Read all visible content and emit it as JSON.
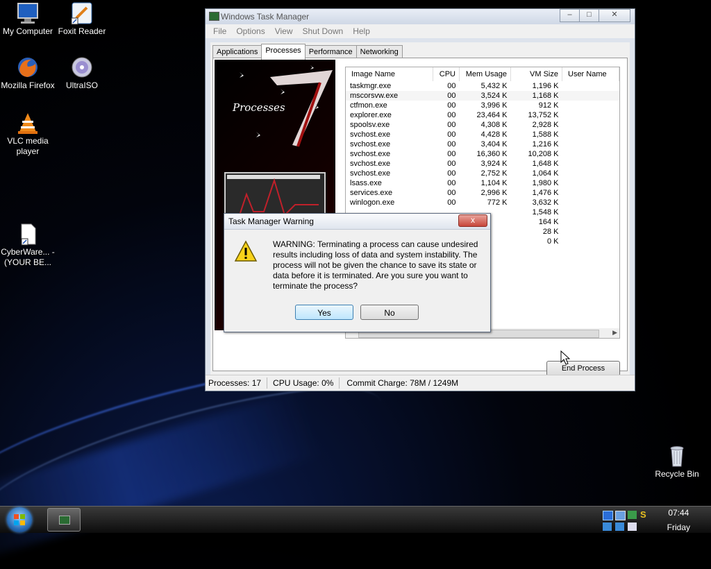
{
  "desktop": {
    "icons": [
      {
        "label": "My Computer",
        "icon": "computer-icon"
      },
      {
        "label": "Foxit Reader",
        "icon": "pdf-reader-icon"
      },
      {
        "label": "Mozilla Firefox",
        "icon": "firefox-icon"
      },
      {
        "label": "UltraISO",
        "icon": "disc-icon"
      },
      {
        "label": "VLC media player",
        "icon": "vlc-icon"
      },
      {
        "label": "CyberWare... - (YOUR BE...",
        "icon": "file-shortcut-icon"
      },
      {
        "label": "Recycle Bin",
        "icon": "recycle-bin-icon"
      }
    ]
  },
  "task_manager": {
    "title": "Windows Task Manager",
    "menu": [
      "File",
      "Options",
      "View",
      "Shut Down",
      "Help"
    ],
    "tabs": [
      "Applications",
      "Processes",
      "Performance",
      "Networking"
    ],
    "active_tab": "Processes",
    "art_label": "Processes",
    "columns": [
      "Image Name",
      "CPU",
      "Mem Usage",
      "VM Size",
      "User Name"
    ],
    "rows": [
      [
        "taskmgr.exe",
        "00",
        "5,432 K",
        "1,196 K",
        ""
      ],
      [
        "mscorsvw.exe",
        "00",
        "3,524 K",
        "1,168 K",
        ""
      ],
      [
        "ctfmon.exe",
        "00",
        "3,996 K",
        "912 K",
        ""
      ],
      [
        "explorer.exe",
        "00",
        "23,464 K",
        "13,752 K",
        ""
      ],
      [
        "spoolsv.exe",
        "00",
        "4,308 K",
        "2,928 K",
        ""
      ],
      [
        "svchost.exe",
        "00",
        "4,428 K",
        "1,588 K",
        ""
      ],
      [
        "svchost.exe",
        "00",
        "3,404 K",
        "1,216 K",
        ""
      ],
      [
        "svchost.exe",
        "00",
        "16,360 K",
        "10,208 K",
        ""
      ],
      [
        "svchost.exe",
        "00",
        "3,924 K",
        "1,648 K",
        ""
      ],
      [
        "svchost.exe",
        "00",
        "2,752 K",
        "1,064 K",
        ""
      ],
      [
        "lsass.exe",
        "00",
        "1,104 K",
        "1,980 K",
        ""
      ],
      [
        "services.exe",
        "00",
        "2,996 K",
        "1,476 K",
        ""
      ],
      [
        "winlogon.exe",
        "00",
        "772 K",
        "3,632 K",
        ""
      ],
      [
        "",
        "",
        "",
        "1,548 K",
        ""
      ],
      [
        "",
        "",
        "",
        "164 K",
        ""
      ],
      [
        "",
        "",
        "",
        "28 K",
        ""
      ],
      [
        "",
        "",
        "",
        "0 K",
        ""
      ]
    ],
    "end_process_label": "End Process",
    "status": {
      "processes": "Processes: 17",
      "cpu": "CPU Usage: 0%",
      "commit": "Commit Charge: 78M / 1249M"
    }
  },
  "warning_dialog": {
    "title": "Task Manager Warning",
    "message": "WARNING: Terminating a process can cause undesired results including loss of data and system instability. The process will not be given the chance to save its state or data before it is terminated.  Are you sure you want to terminate the process?",
    "yes_label": "Yes",
    "no_label": "No",
    "close_label": "x"
  },
  "taskbar": {
    "time": "07:44",
    "day": "Friday"
  }
}
